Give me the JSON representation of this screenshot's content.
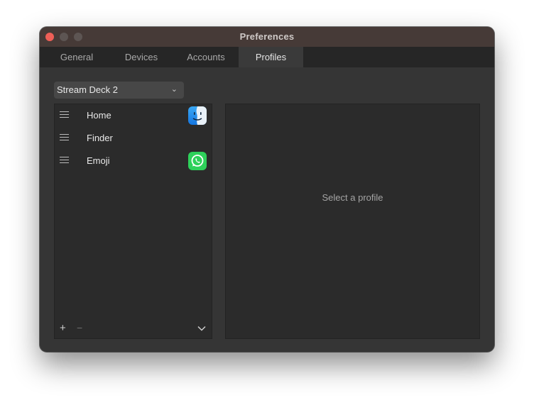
{
  "window": {
    "title": "Preferences"
  },
  "tabs": [
    {
      "label": "General",
      "active": false
    },
    {
      "label": "Devices",
      "active": false
    },
    {
      "label": "Accounts",
      "active": false
    },
    {
      "label": "Profiles",
      "active": true
    }
  ],
  "device_select": {
    "value": "Stream Deck 2"
  },
  "profiles": [
    {
      "label": "Home",
      "icon": "finder-app-icon"
    },
    {
      "label": "Finder",
      "icon": ""
    },
    {
      "label": "Emoji",
      "icon": "whatsapp-app-icon"
    }
  ],
  "list_footer": {
    "add_icon": "plus-icon",
    "remove_icon": "minus-icon",
    "menu_icon": "chevron-down-icon"
  },
  "detail": {
    "placeholder": "Select a profile"
  },
  "colors": {
    "close": "#ee5f57",
    "finder_blue": "#1e8ef0",
    "whatsapp_green": "#2ed15a"
  }
}
